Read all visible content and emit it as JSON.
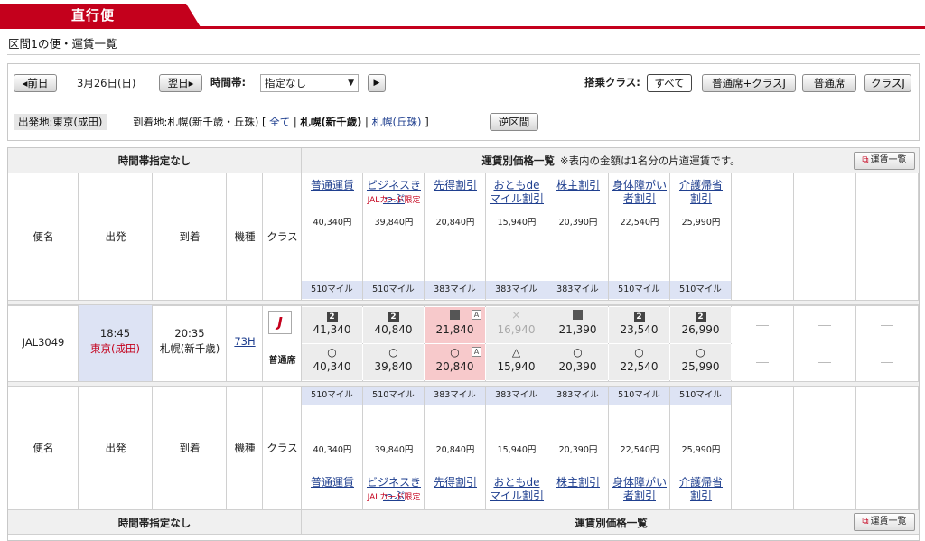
{
  "header": {
    "tab_label": "直行便",
    "subtitle": "区間1の便・運賃一覧"
  },
  "search": {
    "prev_day": "◂前日",
    "date": "3月26日(日)",
    "next_day": "翌日▸",
    "time_label": "時間帯:",
    "time_value": "指定なし",
    "select_arrow": "▼",
    "go": "▶",
    "class_label": "搭乗クラス:",
    "class_buttons": [
      "すべて",
      "普通席+クラスJ",
      "普通席",
      "クラスJ"
    ],
    "origin": "出発地:東京(成田)",
    "dest_label": "到着地:札幌(新千歳・丘珠)",
    "bracket_open": "[",
    "all": "全て",
    "sep1": "|",
    "dest1": "札幌(新千歳)",
    "sep2": "|",
    "dest2": "札幌(丘珠)",
    "bracket_close": "]",
    "reverse": "逆区間"
  },
  "table": {
    "time_header": "時間帯指定なし",
    "fare_header": "運賃別価格一覧",
    "fare_note": "※表内の金額は1名分の片道運賃です。",
    "fare_list_button": "運賃一覧",
    "columns": {
      "flight": "便名",
      "dep": "出発",
      "arr": "到着",
      "aircraft": "機種",
      "class": "クラス"
    },
    "fares": [
      {
        "name1": "普通運賃",
        "name2": "",
        "sub": "",
        "price": "40,340円",
        "miles": "510マイル"
      },
      {
        "name1": "ビジネスきっぷ",
        "name2": "",
        "sub": "JALカード限定",
        "price": "39,840円",
        "miles": "510マイル"
      },
      {
        "name1": "先得割引",
        "name2": "",
        "sub": "",
        "price": "20,840円",
        "miles": "383マイル"
      },
      {
        "name1": "おともde",
        "name2": "マイル割引",
        "sub": "",
        "price": "15,940円",
        "miles": "383マイル"
      },
      {
        "name1": "株主割引",
        "name2": "",
        "sub": "",
        "price": "20,390円",
        "miles": "383マイル"
      },
      {
        "name1": "身体障がい",
        "name2": "者割引",
        "sub": "",
        "price": "22,540円",
        "miles": "510マイル"
      },
      {
        "name1": "介護帰省",
        "name2": "割引",
        "sub": "",
        "price": "25,990円",
        "miles": "510マイル"
      }
    ],
    "flight": {
      "number": "JAL3049",
      "dep_time": "18:45",
      "dep_place": "東京(成田)",
      "arr_time": "20:35",
      "arr_place": "札幌(新千歳)",
      "aircraft": "73H",
      "class_logo": "J",
      "class_name": "普通席"
    },
    "row_upper": [
      {
        "sym": "2",
        "val": "41,340",
        "a": false,
        "state": "avail"
      },
      {
        "sym": "2",
        "val": "40,840",
        "a": false,
        "state": "avail"
      },
      {
        "sym": "■",
        "val": "21,840",
        "a": true,
        "state": "pink"
      },
      {
        "sym": "×",
        "val": "16,940",
        "a": false,
        "state": "gray"
      },
      {
        "sym": "■",
        "val": "21,390",
        "a": false,
        "state": "avail"
      },
      {
        "sym": "2",
        "val": "23,540",
        "a": false,
        "state": "avail"
      },
      {
        "sym": "2",
        "val": "26,990",
        "a": false,
        "state": "avail"
      }
    ],
    "row_lower": [
      {
        "sym": "○",
        "val": "40,340",
        "a": false,
        "state": "avail"
      },
      {
        "sym": "○",
        "val": "39,840",
        "a": false,
        "state": "avail"
      },
      {
        "sym": "○",
        "val": "20,840",
        "a": true,
        "state": "pink"
      },
      {
        "sym": "△",
        "val": "15,940",
        "a": false,
        "state": "avail"
      },
      {
        "sym": "○",
        "val": "20,390",
        "a": false,
        "state": "avail"
      },
      {
        "sym": "○",
        "val": "22,540",
        "a": false,
        "state": "avail"
      },
      {
        "sym": "○",
        "val": "25,990",
        "a": false,
        "state": "avail"
      }
    ],
    "a_mark": "A",
    "empty_mark": "—"
  }
}
